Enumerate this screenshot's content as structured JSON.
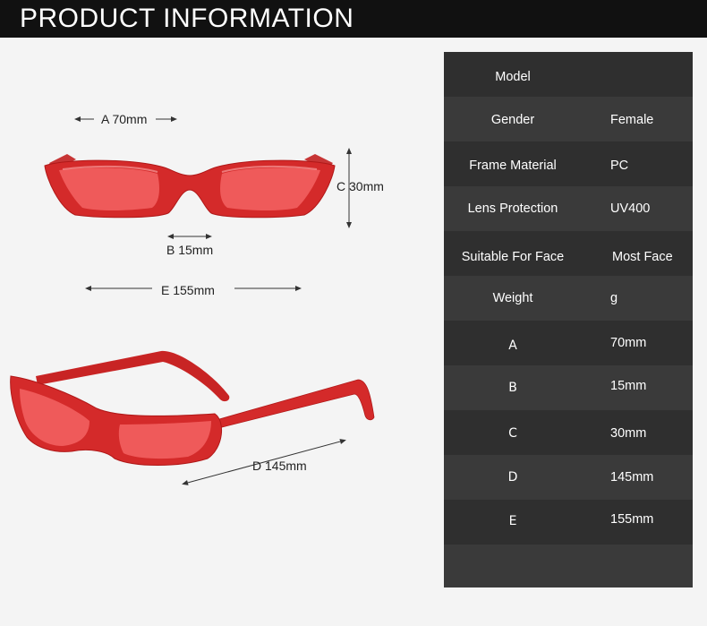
{
  "header": {
    "title": "PRODUCT INFORMATION"
  },
  "dimensions": {
    "a": "A 70mm",
    "b": "B 15mm",
    "c": "C 30mm",
    "d": "D 145mm",
    "e": "E 155mm"
  },
  "colors": {
    "frame_red": "#d42a2a",
    "lens_red": "#ef5a5a",
    "row_dark": "#2f2f2f",
    "row_light": "#3a3a3a"
  },
  "specs": [
    {
      "key": "Model",
      "value": ""
    },
    {
      "key": "Gender",
      "value": "Female"
    },
    {
      "key": "Frame Material",
      "value": "PC"
    },
    {
      "key": "Lens Protection",
      "value": "UV400"
    },
    {
      "key": "Suitable For Face",
      "value": "Most Face"
    },
    {
      "key": "Weight",
      "value": "g"
    },
    {
      "key": "A",
      "value": "70mm"
    },
    {
      "key": "B",
      "value": "15mm"
    },
    {
      "key": "C",
      "value": "30mm"
    },
    {
      "key": "D",
      "value": "145mm"
    },
    {
      "key": "E",
      "value": "155mm"
    }
  ]
}
